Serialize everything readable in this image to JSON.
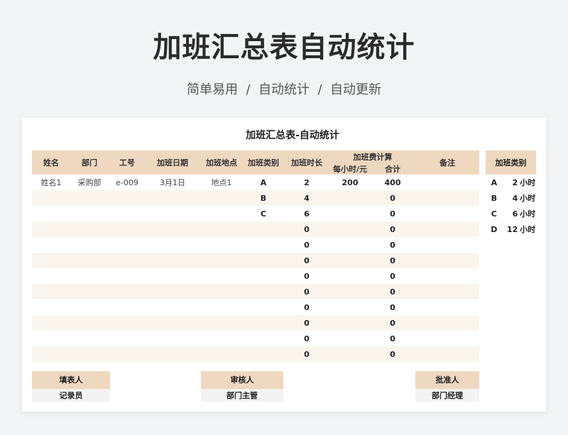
{
  "hero": {
    "title": "加班汇总表自动统计",
    "subtitle": "简单易用  /  自动统计  /  自动更新"
  },
  "sheet": {
    "title": "加班汇总表-自动统计",
    "headers": {
      "name": "姓名",
      "dept": "部门",
      "id": "工号",
      "date": "加班日期",
      "location": "加班地点",
      "category": "加班类别",
      "hours": "加班时长",
      "fee_group": "加班费计算",
      "per_hour": "每小时/元",
      "total": "合计",
      "remark": "备注"
    },
    "rows": [
      {
        "name": "姓名1",
        "dept": "采购部",
        "id": "e-009",
        "date": "3月1日",
        "location": "地点1",
        "category": "A",
        "hours": "2",
        "per_hour": "200",
        "total": "400",
        "remark": ""
      },
      {
        "name": "",
        "dept": "",
        "id": "",
        "date": "",
        "location": "",
        "category": "B",
        "hours": "4",
        "per_hour": "",
        "total": "0",
        "remark": ""
      },
      {
        "name": "",
        "dept": "",
        "id": "",
        "date": "",
        "location": "",
        "category": "C",
        "hours": "6",
        "per_hour": "",
        "total": "0",
        "remark": ""
      },
      {
        "name": "",
        "dept": "",
        "id": "",
        "date": "",
        "location": "",
        "category": "",
        "hours": "0",
        "per_hour": "",
        "total": "0",
        "remark": ""
      },
      {
        "name": "",
        "dept": "",
        "id": "",
        "date": "",
        "location": "",
        "category": "",
        "hours": "0",
        "per_hour": "",
        "total": "0",
        "remark": ""
      },
      {
        "name": "",
        "dept": "",
        "id": "",
        "date": "",
        "location": "",
        "category": "",
        "hours": "0",
        "per_hour": "",
        "total": "0",
        "remark": ""
      },
      {
        "name": "",
        "dept": "",
        "id": "",
        "date": "",
        "location": "",
        "category": "",
        "hours": "0",
        "per_hour": "",
        "total": "0",
        "remark": ""
      },
      {
        "name": "",
        "dept": "",
        "id": "",
        "date": "",
        "location": "",
        "category": "",
        "hours": "0",
        "per_hour": "",
        "total": "0",
        "remark": ""
      },
      {
        "name": "",
        "dept": "",
        "id": "",
        "date": "",
        "location": "",
        "category": "",
        "hours": "0",
        "per_hour": "",
        "total": "0",
        "remark": ""
      },
      {
        "name": "",
        "dept": "",
        "id": "",
        "date": "",
        "location": "",
        "category": "",
        "hours": "0",
        "per_hour": "",
        "total": "0",
        "remark": ""
      },
      {
        "name": "",
        "dept": "",
        "id": "",
        "date": "",
        "location": "",
        "category": "",
        "hours": "0",
        "per_hour": "",
        "total": "0",
        "remark": ""
      },
      {
        "name": "",
        "dept": "",
        "id": "",
        "date": "",
        "location": "",
        "category": "",
        "hours": "0",
        "per_hour": "",
        "total": "0",
        "remark": ""
      }
    ],
    "category_table": {
      "header": "加班类别",
      "rows": [
        {
          "key": "A",
          "value": "2",
          "unit": "小时"
        },
        {
          "key": "B",
          "value": "4",
          "unit": "小时"
        },
        {
          "key": "C",
          "value": "6",
          "unit": "小时"
        },
        {
          "key": "D",
          "value": "12",
          "unit": "小时"
        }
      ]
    },
    "signatures": {
      "filler": {
        "label": "填表人",
        "value": "记录员"
      },
      "reviewer": {
        "label": "审核人",
        "value": "部门主管"
      },
      "approver": {
        "label": "批准人",
        "value": "部门经理"
      }
    }
  },
  "colors": {
    "header_bg": "#efd8c0",
    "stripe_bg": "#faf6ee",
    "page_bg": "#f2f4f6"
  }
}
